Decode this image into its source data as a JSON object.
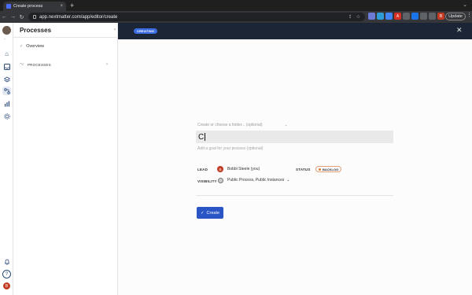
{
  "browser": {
    "tab_title": "Create process",
    "tab_close": "×",
    "new_tab": "+",
    "url": "app.nextmatter.com/app/editor/create",
    "update_label": "Update",
    "window_controls": "⌄",
    "nav": {
      "back": "←",
      "forward": "→",
      "reload": "↻"
    },
    "extensions": [
      {
        "label": "",
        "color": "#6b7bd6"
      },
      {
        "label": "",
        "color": "#2f9bd7"
      },
      {
        "label": "",
        "color": "#4285f4"
      },
      {
        "label": "A",
        "color": "#d93025"
      },
      {
        "label": "",
        "color": "#5f6368"
      },
      {
        "label": "",
        "color": "#1a73e8"
      },
      {
        "label": "",
        "color": "#5f6368"
      },
      {
        "label": "",
        "color": "#5f6368"
      },
      {
        "label": "B",
        "color": "#c23b22"
      }
    ]
  },
  "rail": {
    "avatar_initial": "B",
    "icons": [
      "home-icon",
      "inbox-icon",
      "layers-icon",
      "processes-icon",
      "analytics-icon",
      "integrations-icon"
    ],
    "bottom_icons": [
      "bell-icon",
      "help-icon"
    ]
  },
  "sidebar": {
    "title": "Processes",
    "collapse": "‹",
    "items": [
      {
        "label": "Overview",
        "icon": "✓"
      },
      {
        "label": "PROCESSES",
        "icon": "⌥"
      }
    ]
  },
  "header": {
    "badge": "CREATING",
    "close": "✕"
  },
  "form": {
    "folder_placeholder": "Create or choose a folder... (optional)",
    "folder_chevron": "⌄",
    "title_value": "C",
    "goal_placeholder": "Add a goal for your process (optional)",
    "lead_label": "LEAD",
    "lead_initial": "B",
    "lead_name": "Bobbi Steele (you)",
    "status_label": "STATUS",
    "status_value": "BACKLOG",
    "visibility_label": "VISIBILITY",
    "visibility_value": "Public Process, Public Instances",
    "visibility_chevron": "⌄",
    "create_button": "Create",
    "create_icon": "✓"
  },
  "colors": {
    "accent": "#2a55c4",
    "header_bg": "#1b2535",
    "badge": "#3b6de0",
    "status_dot": "#e07a2c"
  }
}
